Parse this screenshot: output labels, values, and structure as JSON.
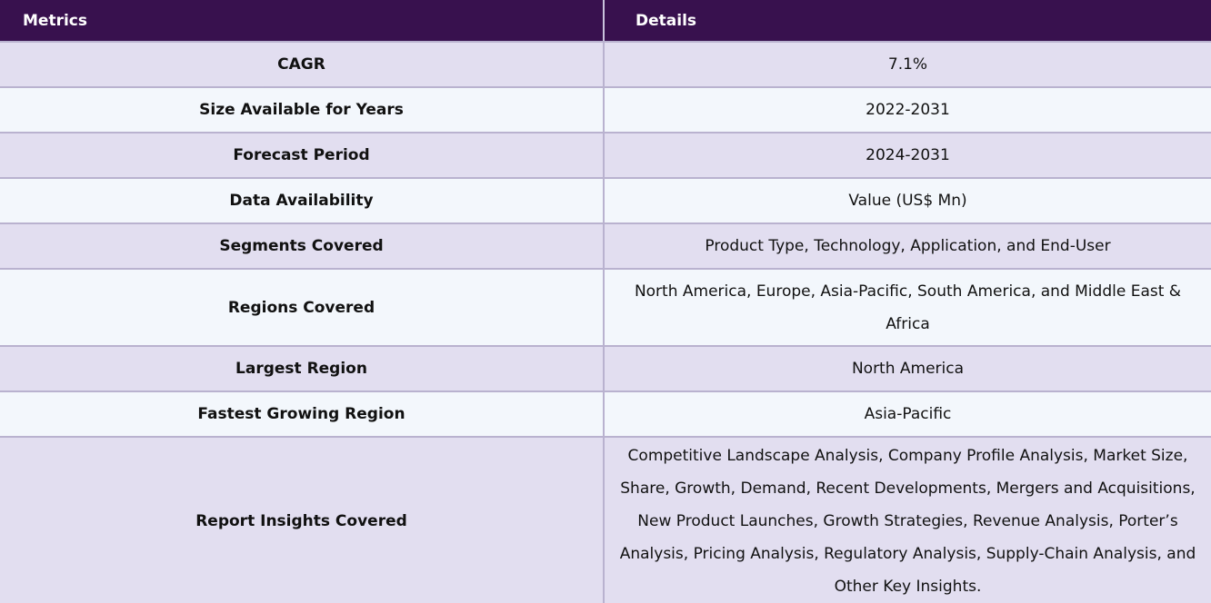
{
  "table": {
    "headers": [
      "Metrics",
      "Details"
    ],
    "rows": [
      {
        "metric": "CAGR",
        "detail": "7.1%"
      },
      {
        "metric": "Size Available for Years",
        "detail": "2022-2031"
      },
      {
        "metric": "Forecast Period",
        "detail": "2024-2031"
      },
      {
        "metric": "Data Availability",
        "detail": "Value (US$ Mn)"
      },
      {
        "metric": "Segments Covered",
        "detail": "Product Type, Technology, Application, and End-User"
      },
      {
        "metric": "Regions Covered",
        "detail": "North America, Europe, Asia-Pacific, South America, and Middle East & Africa"
      },
      {
        "metric": "Largest Region",
        "detail": "North America"
      },
      {
        "metric": "Fastest Growing Region",
        "detail": "Asia-Pacific"
      },
      {
        "metric": "Report Insights Covered",
        "detail": "Competitive Landscape Analysis, Company Profile Analysis, Market Size, Share, Growth, Demand, Recent Developments, Mergers and Acquisitions, New Product Launches, Growth Strategies, Revenue Analysis, Porter’s Analysis, Pricing Analysis, Regulatory Analysis, Supply-Chain Analysis, and Other Key Insights."
      }
    ]
  },
  "colors": {
    "header_bg": "#38114e",
    "row_odd_bg": "#e2def0",
    "row_even_bg": "#f3f7fc",
    "border": "#b9b2cf"
  }
}
